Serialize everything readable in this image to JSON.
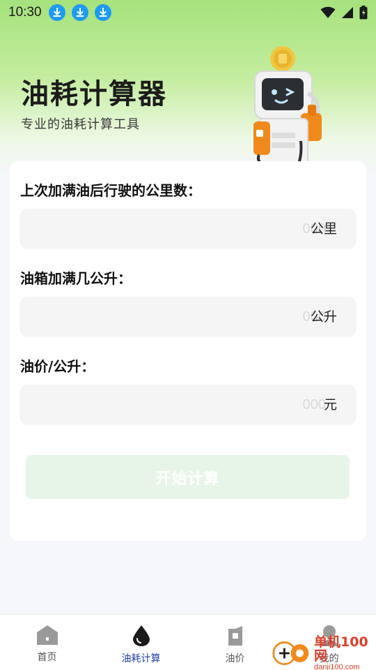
{
  "status_bar": {
    "time": "10:30",
    "download_icons": 3
  },
  "hero": {
    "title": "油耗计算器",
    "subtitle": "专业的油耗计算工具"
  },
  "form": {
    "mileage": {
      "label": "上次加满油后行驶的公里数：",
      "placeholder": "000",
      "value": "",
      "unit": "公里"
    },
    "liters": {
      "label": "油箱加满几公升：",
      "placeholder": "000",
      "value": "",
      "unit": "公升"
    },
    "price": {
      "label": "油价/公升：",
      "placeholder": "000",
      "value": "",
      "unit": "元"
    },
    "submit_label": "开始计算"
  },
  "tabbar": {
    "items": [
      {
        "label": "首页",
        "icon": "home-icon",
        "active": false
      },
      {
        "label": "油耗计算",
        "icon": "oil-drop-icon",
        "active": true
      },
      {
        "label": "油价",
        "icon": "fuel-can-icon",
        "active": false
      },
      {
        "label": "我的",
        "icon": "user-icon",
        "active": false
      }
    ]
  },
  "watermark": {
    "main": "单机100网",
    "sub": "danji100.com"
  },
  "colors": {
    "accent_green": "#a6e27d",
    "active_tab": "#1f3fb0",
    "button_bg": "#e6f5e7",
    "download_badge": "#1e9bf0"
  }
}
